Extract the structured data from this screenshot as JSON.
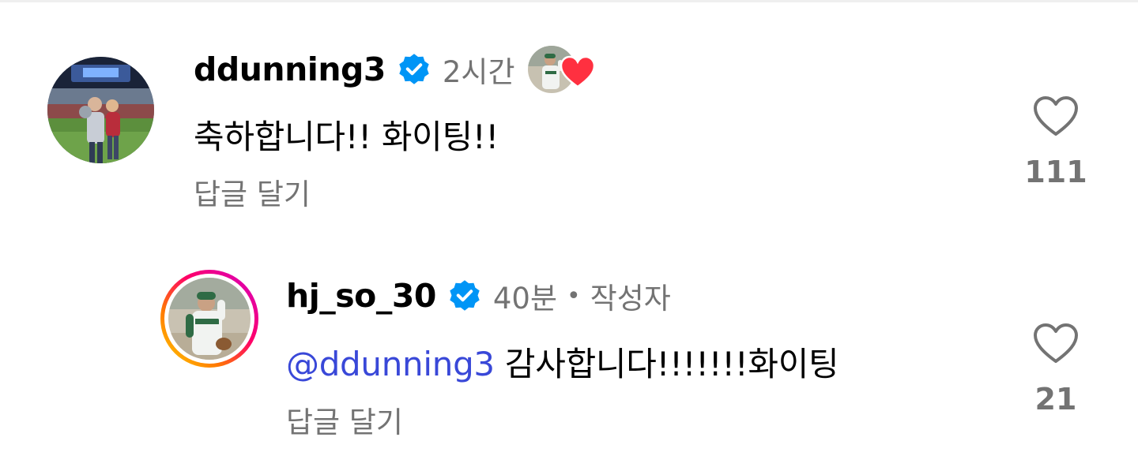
{
  "comments": [
    {
      "username": "ddunning3",
      "time": "2시간",
      "text": "축하합니다!! 화이팅!!",
      "reply_label": "답글 달기",
      "likes": "111",
      "liked_by_author": true
    },
    {
      "username": "hj_so_30",
      "time": "40분",
      "separator": "•",
      "author_label": "작성자",
      "mention": "@ddunning3",
      "text": " 감사합니다!!!!!!!화이팅",
      "reply_label": "답글 달기",
      "likes": "21"
    }
  ],
  "icons": {
    "verified": "verified-badge-icon",
    "like": "heart-outline-icon",
    "liked": "heart-filled-icon"
  },
  "colors": {
    "verified_blue": "#0095f6",
    "mention": "#3948d8",
    "muted": "#737373",
    "heart_red": "#ff3040"
  }
}
